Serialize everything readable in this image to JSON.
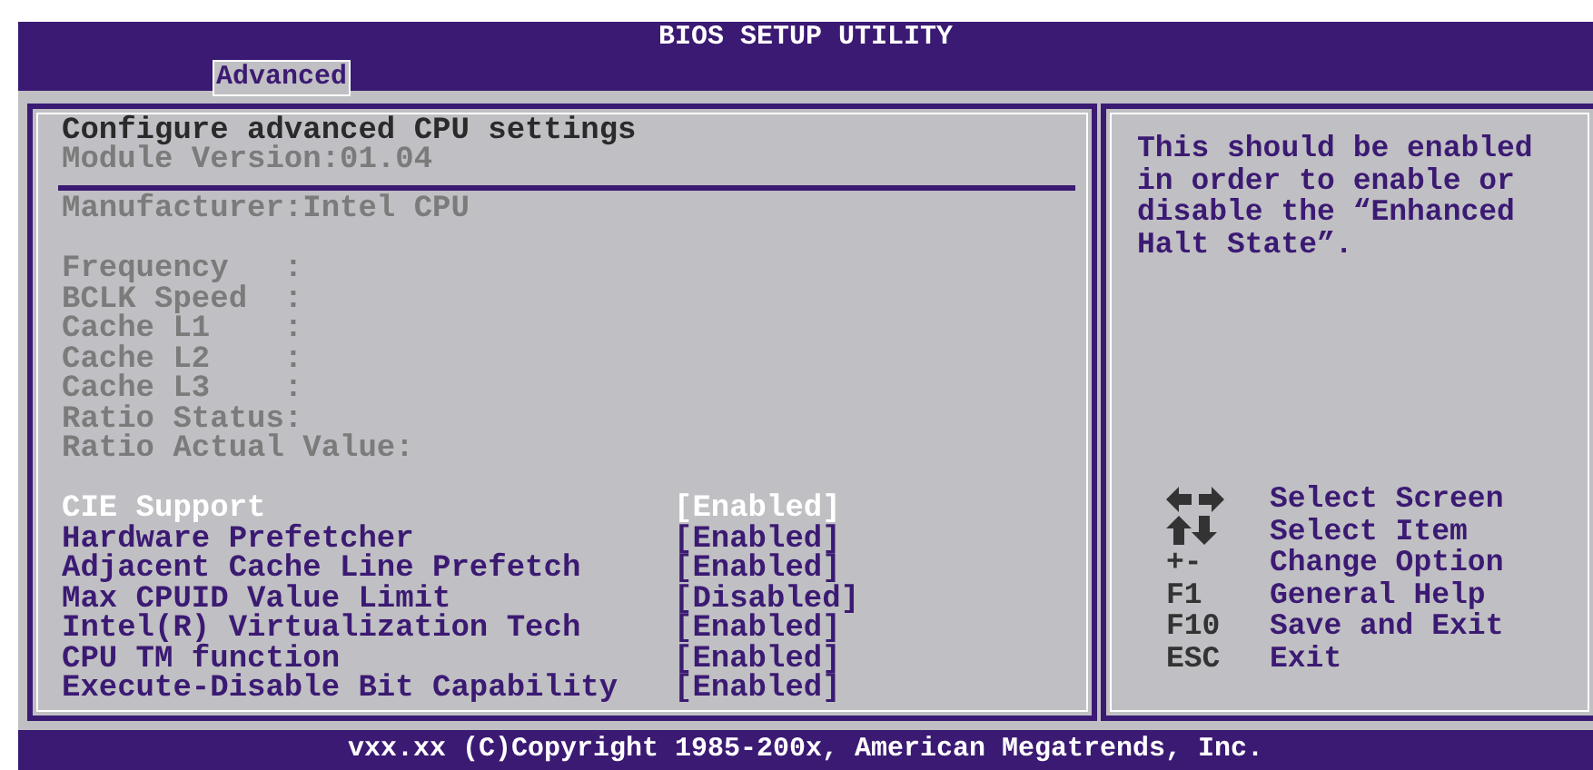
{
  "window": {
    "title": "BIOS SETUP UTILITY"
  },
  "tabs": [
    {
      "label": "Advanced",
      "selected": true
    }
  ],
  "panel": {
    "heading": "Configure advanced CPU settings",
    "module_version": "Module Version:01.04",
    "info": [
      {
        "kind": "text",
        "text": "Manufacturer:Intel CPU"
      },
      {
        "kind": "blank"
      },
      {
        "kind": "text",
        "text": "Frequency   :"
      },
      {
        "kind": "text",
        "text": "BCLK Speed  :"
      },
      {
        "kind": "text",
        "text": "Cache L1    :"
      },
      {
        "kind": "text",
        "text": "Cache L2    :"
      },
      {
        "kind": "text",
        "text": "Cache L3    :"
      },
      {
        "kind": "text",
        "text": "Ratio Status:"
      },
      {
        "kind": "text",
        "text": "Ratio Actual Value:"
      }
    ],
    "options": [
      {
        "label": "CIE Support",
        "value": "[Enabled]",
        "selected": true
      },
      {
        "label": "Hardware Prefetcher",
        "value": "[Enabled]",
        "selected": false
      },
      {
        "label": "Adjacent Cache Line Prefetch",
        "value": "[Enabled]",
        "selected": false
      },
      {
        "label": "Max CPUID Value Limit",
        "value": "[Disabled]",
        "selected": false
      },
      {
        "label": "Intel(R) Virtualization Tech",
        "value": "[Enabled]",
        "selected": false
      },
      {
        "label": "CPU TM function",
        "value": "[Enabled]",
        "selected": false
      },
      {
        "label": "Execute-Disable Bit Capability",
        "value": "[Enabled]",
        "selected": false
      }
    ]
  },
  "help": {
    "text": "This should be enabled in order to enable or disable the “Enhanced Halt State”.",
    "keys": [
      {
        "kind": "left-right",
        "action": "Select Screen"
      },
      {
        "kind": "up-down",
        "action": "Select Item"
      },
      {
        "kind": "text",
        "key": "+-",
        "action": "Change Option"
      },
      {
        "kind": "text",
        "key": "F1",
        "action": "General Help"
      },
      {
        "kind": "text",
        "key": "F10",
        "action": "Save and Exit"
      },
      {
        "kind": "text",
        "key": "ESC",
        "action": "Exit"
      }
    ]
  },
  "status_bar": "vxx.xx (C)Copyright 1985-200x, American Megatrends, Inc."
}
